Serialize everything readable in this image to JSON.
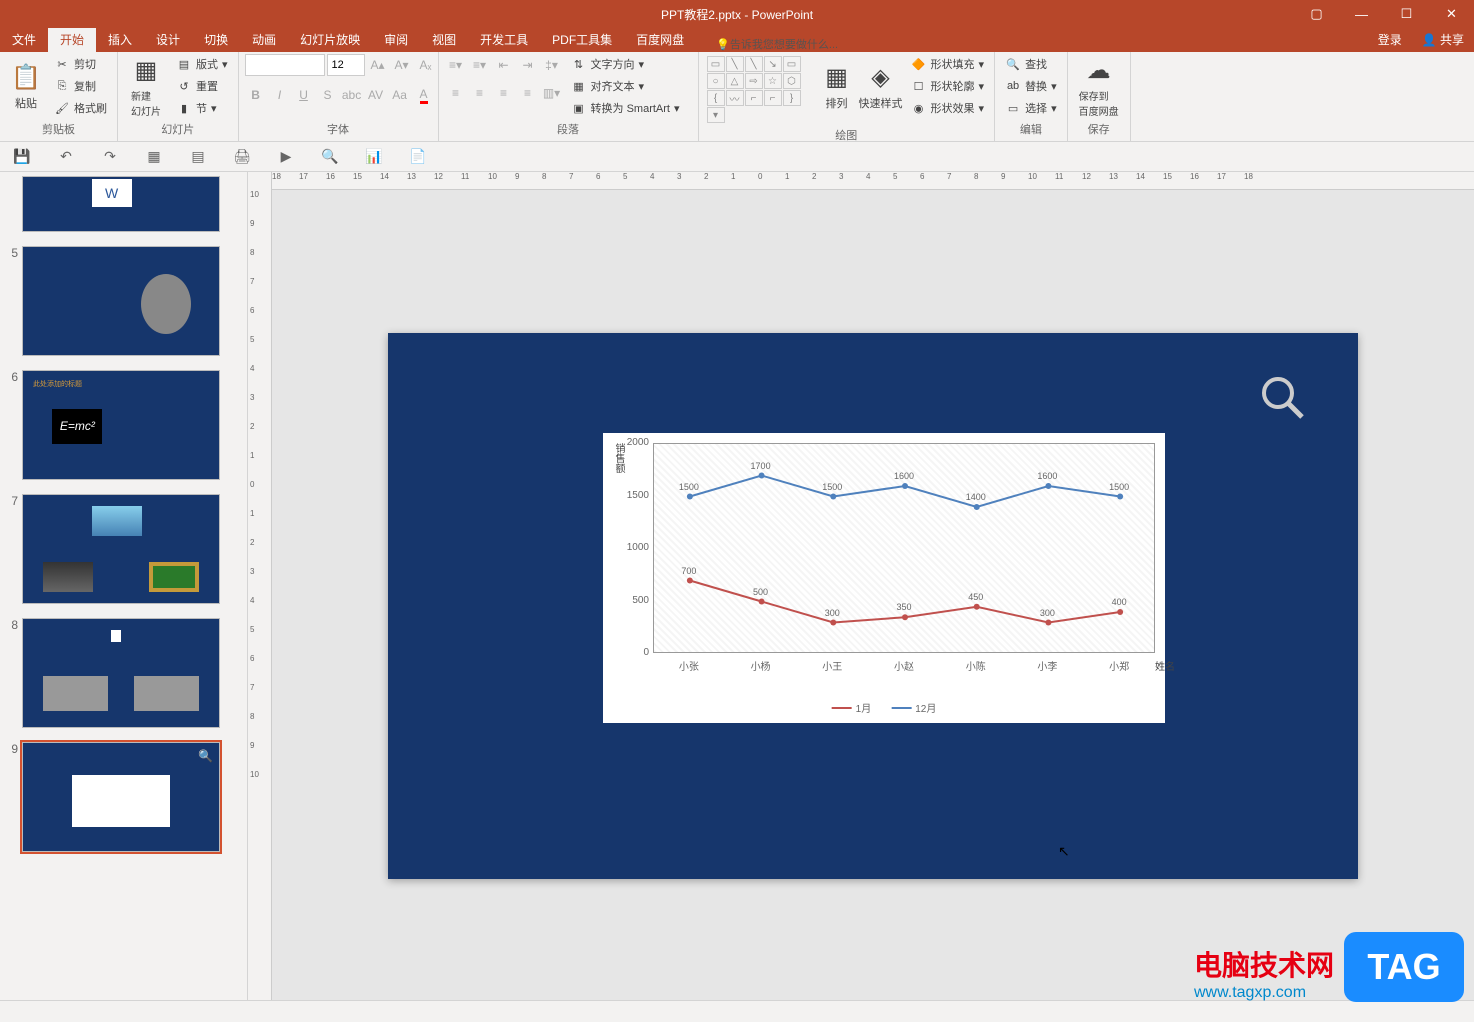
{
  "titlebar": {
    "title": "PPT教程2.pptx - PowerPoint"
  },
  "menu": {
    "tabs": [
      "文件",
      "开始",
      "插入",
      "设计",
      "切换",
      "动画",
      "幻灯片放映",
      "审阅",
      "视图",
      "开发工具",
      "PDF工具集",
      "百度网盘"
    ],
    "active": 1,
    "tellme_placeholder": "告诉我您想要做什么...",
    "right": [
      "登录",
      "共享"
    ]
  },
  "ribbon": {
    "clipboard": {
      "paste": "粘贴",
      "cut": "剪切",
      "copy": "复制",
      "format_painter": "格式刷",
      "label": "剪贴板"
    },
    "slides": {
      "new_slide": "新建\n幻灯片",
      "layout": "版式",
      "reset": "重置",
      "section": "节",
      "label": "幻灯片"
    },
    "font": {
      "size": "12",
      "label": "字体"
    },
    "paragraph": {
      "text_direction": "文字方向",
      "align_text": "对齐文本",
      "smartart": "转换为 SmartArt",
      "label": "段落"
    },
    "drawing": {
      "arrange": "排列",
      "quick_styles": "快速样式",
      "shape_fill": "形状填充",
      "shape_outline": "形状轮廓",
      "shape_effects": "形状效果",
      "label": "绘图"
    },
    "editing": {
      "find": "查找",
      "replace": "替换",
      "select": "选择",
      "label": "编辑"
    },
    "save": {
      "save_to": "保存到\n百度网盘",
      "label": "保存"
    }
  },
  "ruler": {
    "h": [
      "18",
      "17",
      "16",
      "15",
      "14",
      "13",
      "12",
      "11",
      "10",
      "9",
      "8",
      "7",
      "6",
      "5",
      "4",
      "3",
      "2",
      "1",
      "0",
      "1",
      "2",
      "3",
      "4",
      "5",
      "6",
      "7",
      "8",
      "9",
      "10",
      "11",
      "12",
      "13",
      "14",
      "15",
      "16",
      "17",
      "18"
    ],
    "v": [
      "10",
      "9",
      "8",
      "7",
      "6",
      "5",
      "4",
      "3",
      "2",
      "1",
      "0",
      "1",
      "2",
      "3",
      "4",
      "5",
      "6",
      "7",
      "8",
      "9",
      "10"
    ]
  },
  "thumbs": [
    {
      "num": "",
      "type": "partial"
    },
    {
      "num": "5",
      "type": "einstein"
    },
    {
      "num": "6",
      "type": "formula",
      "title": "此处添加的标题"
    },
    {
      "num": "7",
      "type": "photos"
    },
    {
      "num": "8",
      "type": "photos2"
    },
    {
      "num": "9",
      "type": "chart",
      "active": true
    }
  ],
  "chart_data": {
    "type": "line",
    "y_axis_label": "销售额",
    "x_axis_label": "姓名",
    "categories": [
      "小张",
      "小杨",
      "小王",
      "小赵",
      "小陈",
      "小李",
      "小郑"
    ],
    "series": [
      {
        "name": "1月",
        "color": "#c0504d",
        "values": [
          700,
          500,
          300,
          350,
          450,
          300,
          400
        ]
      },
      {
        "name": "12月",
        "color": "#4f81bd",
        "values": [
          1500,
          1700,
          1500,
          1600,
          1400,
          1600,
          1500
        ]
      }
    ],
    "y_ticks": [
      0,
      500,
      1000,
      1500,
      2000
    ],
    "ylim": [
      0,
      2000
    ]
  },
  "watermark": {
    "line1": "电脑技术网",
    "line2": "www.tagxp.com",
    "tag": "TAG"
  }
}
